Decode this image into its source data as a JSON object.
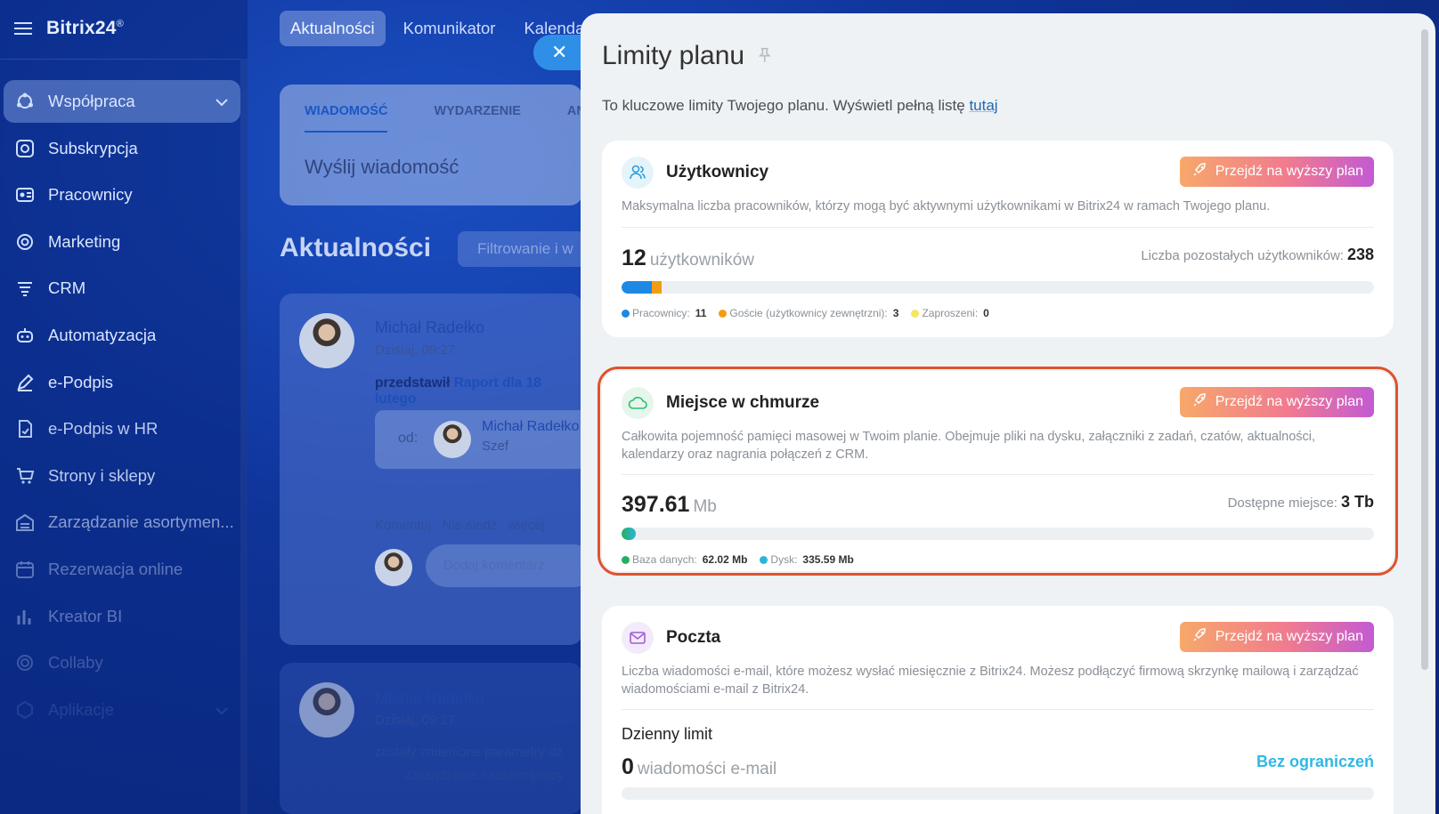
{
  "app": {
    "logo": "Bitrix24",
    "logo_mark": "®"
  },
  "sidebar": {
    "items": [
      {
        "label": "Współpraca",
        "icon": "collaboration-icon"
      },
      {
        "label": "Subskrypcja",
        "icon": "subscription-icon"
      },
      {
        "label": "Pracownicy",
        "icon": "employees-icon"
      },
      {
        "label": "Marketing",
        "icon": "marketing-icon"
      },
      {
        "label": "CRM",
        "icon": "crm-icon"
      },
      {
        "label": "Automatyzacja",
        "icon": "automation-icon"
      },
      {
        "label": "e-Podpis",
        "icon": "signature-icon"
      },
      {
        "label": "e-Podpis w HR",
        "icon": "hr-signature-icon"
      },
      {
        "label": "Strony i sklepy",
        "icon": "cart-icon"
      },
      {
        "label": "Zarządzanie asortymen...",
        "icon": "inventory-icon"
      },
      {
        "label": "Rezerwacja online",
        "icon": "calendar-icon"
      },
      {
        "label": "Kreator BI",
        "icon": "chart-icon"
      },
      {
        "label": "Collaby",
        "icon": "collaby-icon"
      },
      {
        "label": "Aplikacje",
        "icon": "apps-icon"
      }
    ]
  },
  "top_nav": {
    "tabs": [
      "Aktualności",
      "Komunikator",
      "Kalenda"
    ]
  },
  "feed": {
    "tabs": [
      "WIADOMOŚĆ",
      "WYDARZENIE",
      "AN"
    ],
    "input_placeholder": "Wyślij wiadomość",
    "heading": "Aktualności",
    "filter_placeholder": "Filtrowanie i w",
    "post": {
      "author": "Michał Radełko",
      "time": "Dzisiaj, 09:27",
      "text_prefix": "przedstawił",
      "text_link": "Raport dla 18 lutego",
      "from_label": "od:",
      "quoted_name": "Michał Radełko",
      "quoted_role": "Szef",
      "links": [
        "Komentuj",
        "Nie śledź",
        "więcej"
      ],
      "comment_placeholder": "Dodaj komentarz"
    },
    "post2": {
      "author": "Michał Radełko",
      "time": "Dzisiaj, 09:27",
      "text": "zostały zmienione parametry dz",
      "sub": "Zarządzanie czasem pracy"
    }
  },
  "panel": {
    "title": "Limity planu",
    "subtitle": "To kluczowe limity Twojego planu. Wyświetl pełną listę",
    "subtitle_link": "tutaj",
    "upgrade_label": "Przejdź na wyższy plan",
    "users": {
      "title": "Użytkownicy",
      "description": "Maksymalna liczba pracowników, którzy mogą być aktywnymi użytkownikami w Bitrix24 w ramach Twojego planu.",
      "count": "12",
      "unit": "użytkowników",
      "remaining_label": "Liczba pozostałych użytkowników:",
      "remaining_value": "238",
      "bar": {
        "total": 250,
        "employees": 11,
        "guests": 3,
        "invited": 0
      },
      "legend": [
        {
          "label": "Pracownicy:",
          "value": "11",
          "color": "#1e88e5"
        },
        {
          "label": "Goście (użytkownicy zewnętrzni):",
          "value": "3",
          "color": "#f39c12"
        },
        {
          "label": "Zaproszeni:",
          "value": "0",
          "color": "#f5e663"
        }
      ]
    },
    "cloud": {
      "title": "Miejsce w chmurze",
      "description": "Całkowita pojemność pamięci masowej w Twoim planie. Obejmuje pliki na dysku, załączniki z zadań, czatów, aktualności, kalendarzy oraz nagrania połączeń z CRM.",
      "value": "397.61",
      "unit": "Mb",
      "available_label": "Dostępne miejsce:",
      "available_value": "3 Tb",
      "legend": [
        {
          "label": "Baza danych:",
          "value": "62.02 Mb",
          "color": "#27ae60"
        },
        {
          "label": "Dysk:",
          "value": "335.59 Mb",
          "color": "#2bb6d9"
        }
      ]
    },
    "mail": {
      "title": "Poczta",
      "description": "Liczba wiadomości e-mail, które możesz wysłać miesięcznie z Bitrix24. Możesz podłączyć firmową skrzynkę mailową i zarządzać wiadomościami e-mail z Bitrix24.",
      "daily_label": "Dzienny limit",
      "value": "0",
      "unit": "wiadomości e-mail",
      "limit_text": "Bez ograniczeń"
    }
  }
}
